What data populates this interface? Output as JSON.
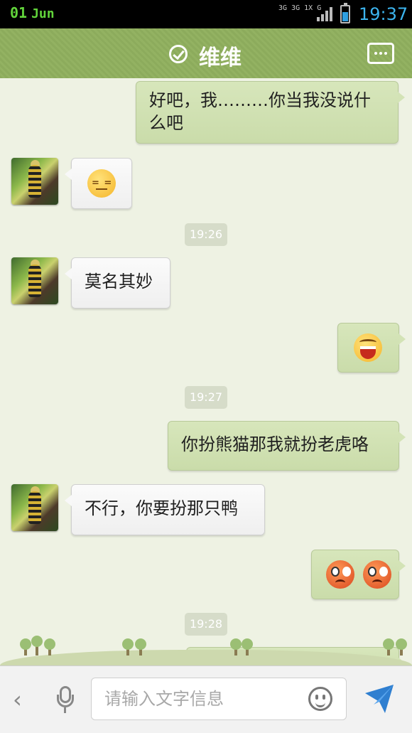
{
  "status_bar": {
    "day": "01",
    "month": "Jun",
    "network_labels": [
      "3G",
      "3G",
      "1X",
      "G"
    ],
    "battery_icon": "battery-icon",
    "time": "19:37"
  },
  "header": {
    "contact_name": "维维",
    "verified_icon": "check-circle-icon",
    "menu_icon": "more-menu-icon"
  },
  "messages": [
    {
      "side": "out",
      "type": "text",
      "text": "好吧，我………你当我没说什",
      "text2": "么吧"
    },
    {
      "side": "in",
      "type": "emoji",
      "emoji": "annoyed-emoji"
    },
    {
      "type": "timestamp",
      "text": "19:26"
    },
    {
      "side": "in",
      "type": "text",
      "text": "莫名其妙"
    },
    {
      "side": "out",
      "type": "emoji",
      "emoji": "laughing-emoji"
    },
    {
      "type": "timestamp",
      "text": "19:27"
    },
    {
      "side": "out",
      "type": "text",
      "text": "你扮熊猫那我就扮老虎咯"
    },
    {
      "side": "in",
      "type": "text",
      "text": "不行，你要扮那只鸭"
    },
    {
      "side": "out",
      "type": "emoji",
      "emoji": "angry-emoji-x2"
    },
    {
      "type": "timestamp",
      "text": "19:28"
    }
  ],
  "input_bar": {
    "placeholder": "请输入文字信息",
    "back_icon": "chevron-left-icon",
    "voice_icon": "microphone-icon",
    "emoji_icon": "smiley-icon",
    "send_icon": "send-icon"
  },
  "colors": {
    "header_green": "#8cab5c",
    "chat_background": "#eef2e3",
    "outgoing_bubble": "#d3e3b6",
    "incoming_bubble": "#f8f8f8",
    "status_time": "#3cb4ee",
    "status_date": "#62d43b"
  }
}
